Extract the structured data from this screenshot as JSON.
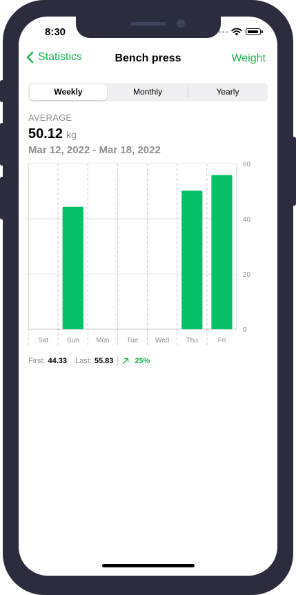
{
  "status": {
    "time": "8:30"
  },
  "nav": {
    "back_label": "Statistics",
    "title": "Bench press",
    "right_label": "Weight"
  },
  "segments": [
    {
      "label": "Weekly",
      "active": true
    },
    {
      "label": "Monthly",
      "active": false
    },
    {
      "label": "Yearly",
      "active": false
    }
  ],
  "summary": {
    "label": "AVERAGE",
    "value": "50.12",
    "unit": "kg",
    "range": "Mar 12, 2022 - Mar 18, 2022"
  },
  "chart_data": {
    "type": "bar",
    "categories": [
      "Sat",
      "Sun",
      "Mon",
      "Tue",
      "Wed",
      "Thu",
      "Fri"
    ],
    "values": [
      0,
      44.33,
      0,
      0,
      0,
      50.2,
      55.83
    ],
    "ylim": [
      0,
      60
    ],
    "yticks": [
      0,
      20,
      40,
      60
    ],
    "bar_color": "#06c167",
    "grid": true
  },
  "footer": {
    "first_label": "First:",
    "first_value": "44.33",
    "last_label": "Last:",
    "last_value": "55.83",
    "change": "25%"
  },
  "colors": {
    "accent": "#1ab34e",
    "frame": "#2b2c3e"
  }
}
